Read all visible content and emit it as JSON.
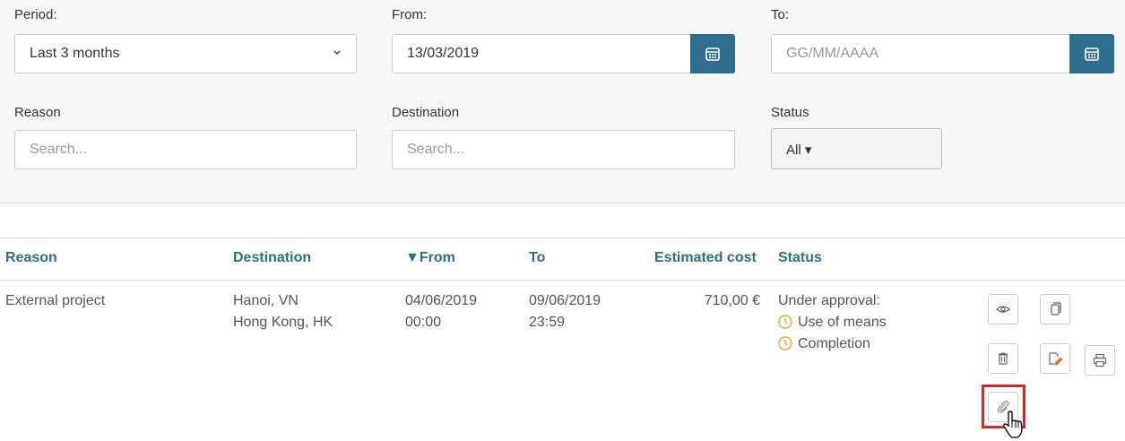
{
  "filters": {
    "period": {
      "label": "Period:",
      "value": "Last 3 months"
    },
    "from": {
      "label": "From:",
      "value": "13/03/2019"
    },
    "to": {
      "label": "To:",
      "placeholder": "GG/MM/AAAA"
    },
    "reason": {
      "label": "Reason",
      "placeholder": "Search..."
    },
    "destination": {
      "label": "Destination",
      "placeholder": "Search..."
    },
    "status": {
      "label": "Status",
      "value": "All ▾"
    }
  },
  "table": {
    "headers": {
      "reason": "Reason",
      "destination": "Destination",
      "from": "▼From",
      "to": "To",
      "cost": "Estimated cost",
      "status": "Status"
    },
    "rows": [
      {
        "reason": "External project",
        "destination_line1": "Hanoi, VN",
        "destination_line2": "Hong Kong, HK",
        "from_date": "04/06/2019",
        "from_time": "00:00",
        "to_date": "09/06/2019",
        "to_time": "23:59",
        "cost": "710,00 €",
        "status_title": "Under approval:",
        "status_items": [
          "Use of means",
          "Completion"
        ]
      }
    ]
  },
  "colors": {
    "accent": "#2c6e8c",
    "warning": "#f0a030",
    "highlight": "#d9262b"
  },
  "icons": [
    "calendar-icon",
    "chevron-down-icon",
    "eye-icon",
    "copy-icon",
    "trash-icon",
    "edit-icon",
    "print-icon",
    "paperclip-icon",
    "clock-icon",
    "hand-cursor-icon"
  ]
}
